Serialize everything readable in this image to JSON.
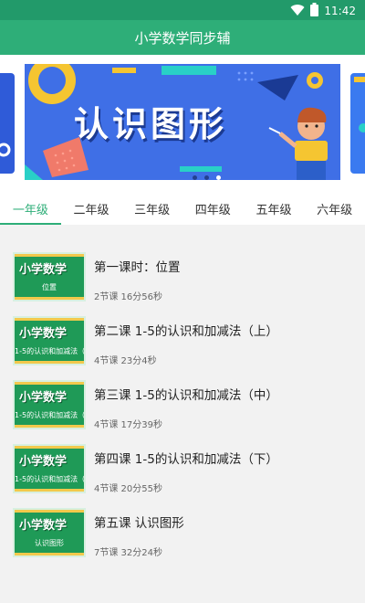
{
  "status": {
    "time": "11:42",
    "wifi_icon": "wifi-icon",
    "battery_icon": "battery-icon"
  },
  "app": {
    "title": "小学数学同步辅"
  },
  "carousel": {
    "banner_text": "认识图形",
    "page_count": 3,
    "active_index": 2
  },
  "tabs": [
    {
      "label": "一年级",
      "active": true
    },
    {
      "label": "二年级",
      "active": false
    },
    {
      "label": "三年级",
      "active": false
    },
    {
      "label": "四年级",
      "active": false
    },
    {
      "label": "五年级",
      "active": false
    },
    {
      "label": "六年级",
      "active": false
    }
  ],
  "lessons": [
    {
      "thumb_title": "小学数学",
      "thumb_sub": "位置",
      "title": "第一课时：位置",
      "meta": "2节课 16分56秒"
    },
    {
      "thumb_title": "小学数学",
      "thumb_sub": "1-5的认识和加减法（上）",
      "title": "第二课 1-5的认识和加减法（上）",
      "meta": "4节课 23分4秒"
    },
    {
      "thumb_title": "小学数学",
      "thumb_sub": "1-5的认识和加减法（中）",
      "title": "第三课 1-5的认识和加减法（中）",
      "meta": "4节课 17分39秒"
    },
    {
      "thumb_title": "小学数学",
      "thumb_sub": "1-5的认识和加减法（下）",
      "title": "第四课 1-5的认识和加减法（下）",
      "meta": "4节课 20分55秒"
    },
    {
      "thumb_title": "小学数学",
      "thumb_sub": "认识图形",
      "title": "第五课 认识图形",
      "meta": "7节课 32分24秒"
    }
  ],
  "colors": {
    "primary": "#2eae78",
    "status_bar": "#229a6a",
    "banner": "#3f6fe6"
  }
}
